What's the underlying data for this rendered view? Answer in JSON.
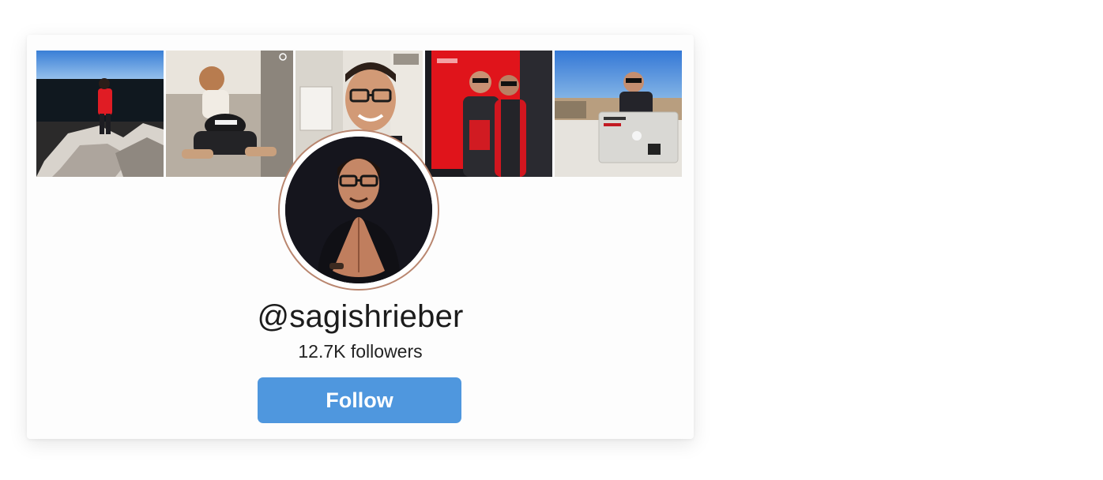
{
  "profile": {
    "username": "@sagishrieber",
    "followers": "12.7K followers"
  },
  "actions": {
    "follow_label": "Follow"
  },
  "colors": {
    "follow_button": "#4f97de",
    "avatar_ring": "#b9866f",
    "card_background": "#fdfdfd"
  },
  "photos": [
    {
      "name": "mountain-hike-photo"
    },
    {
      "name": "family-play-photo"
    },
    {
      "name": "selfie-photo"
    },
    {
      "name": "two-friends-photo"
    },
    {
      "name": "laptop-cafe-photo"
    }
  ]
}
